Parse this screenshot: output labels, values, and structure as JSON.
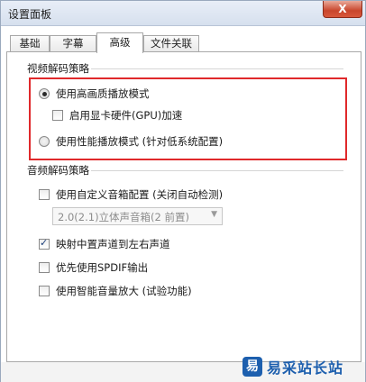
{
  "window": {
    "title": "设置面板",
    "close_symbol": "X"
  },
  "tabs": [
    {
      "label": "基础"
    },
    {
      "label": "字幕"
    },
    {
      "label": "高级"
    },
    {
      "label": "文件关联"
    }
  ],
  "video_section": {
    "title": "视频解码策略",
    "option_hq": {
      "label": "使用高画质播放模式",
      "checked": true
    },
    "gpu": {
      "label": "启用显卡硬件(GPU)加速",
      "checked": false
    },
    "option_perf": {
      "label": "使用性能播放模式 (针对低系统配置)",
      "checked": false
    }
  },
  "audio_section": {
    "title": "音频解码策略",
    "custom": {
      "label": "使用自定义音箱配置 (关闭自动检测)",
      "checked": false
    },
    "speaker_select": {
      "value": "2.0(2.1)立体声音箱(2 前置)",
      "arrow": "▼"
    },
    "map_center": {
      "label": "映射中置声道到左右声道",
      "checked": true
    },
    "spdif": {
      "label": "优先使用SPDIF输出",
      "checked": false
    },
    "amplify": {
      "label": "使用智能音量放大 (试验功能)",
      "checked": false
    }
  },
  "watermark": {
    "logo": "易",
    "text": "易采站长站"
  },
  "colors": {
    "highlight": "#e0292b",
    "brand": "#1d5fae"
  }
}
